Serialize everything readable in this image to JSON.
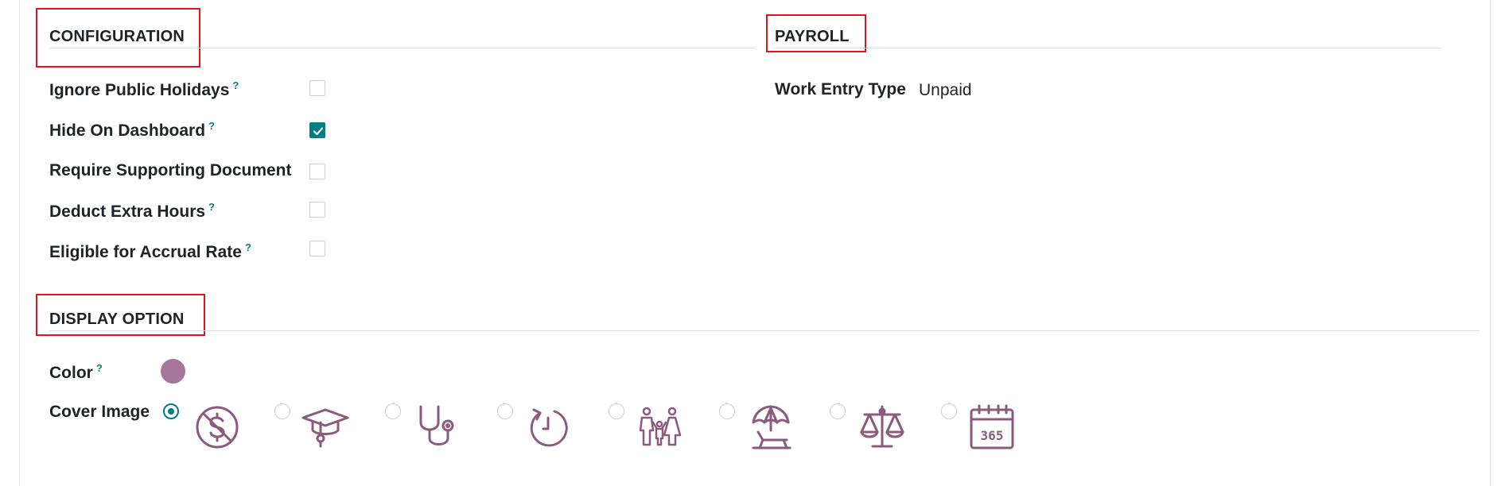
{
  "configuration": {
    "title": "CONFIGURATION",
    "fields": [
      {
        "label": "Ignore Public Holidays",
        "help": "?",
        "checked": false
      },
      {
        "label": "Hide On Dashboard",
        "help": "?",
        "checked": true
      },
      {
        "label": "Require Supporting Document",
        "help": "",
        "checked": false
      },
      {
        "label": "Deduct Extra Hours",
        "help": "?",
        "checked": false
      },
      {
        "label": "Eligible for Accrual Rate",
        "help": "?",
        "checked": false
      }
    ]
  },
  "payroll": {
    "title": "PAYROLL",
    "work_entry_type_label": "Work Entry Type",
    "work_entry_type_value": "Unpaid"
  },
  "display_option": {
    "title": "DISPLAY OPTION",
    "color_label": "Color",
    "color_help": "?",
    "color_value": "#a5769a",
    "cover_image_label": "Cover Image",
    "cover_images": [
      {
        "icon": "no-money-icon",
        "selected": true
      },
      {
        "icon": "graduation-cap-icon",
        "selected": false
      },
      {
        "icon": "stethoscope-icon",
        "selected": false
      },
      {
        "icon": "clock-rewind-icon",
        "selected": false
      },
      {
        "icon": "family-icon",
        "selected": false
      },
      {
        "icon": "beach-umbrella-icon",
        "selected": false
      },
      {
        "icon": "scales-icon",
        "selected": false
      },
      {
        "icon": "calendar-365-icon",
        "selected": false
      }
    ],
    "calendar_text": "365"
  },
  "colors": {
    "accent": "#017e84",
    "icon": "#8b5a7e",
    "highlight_box": "#e0141e"
  }
}
